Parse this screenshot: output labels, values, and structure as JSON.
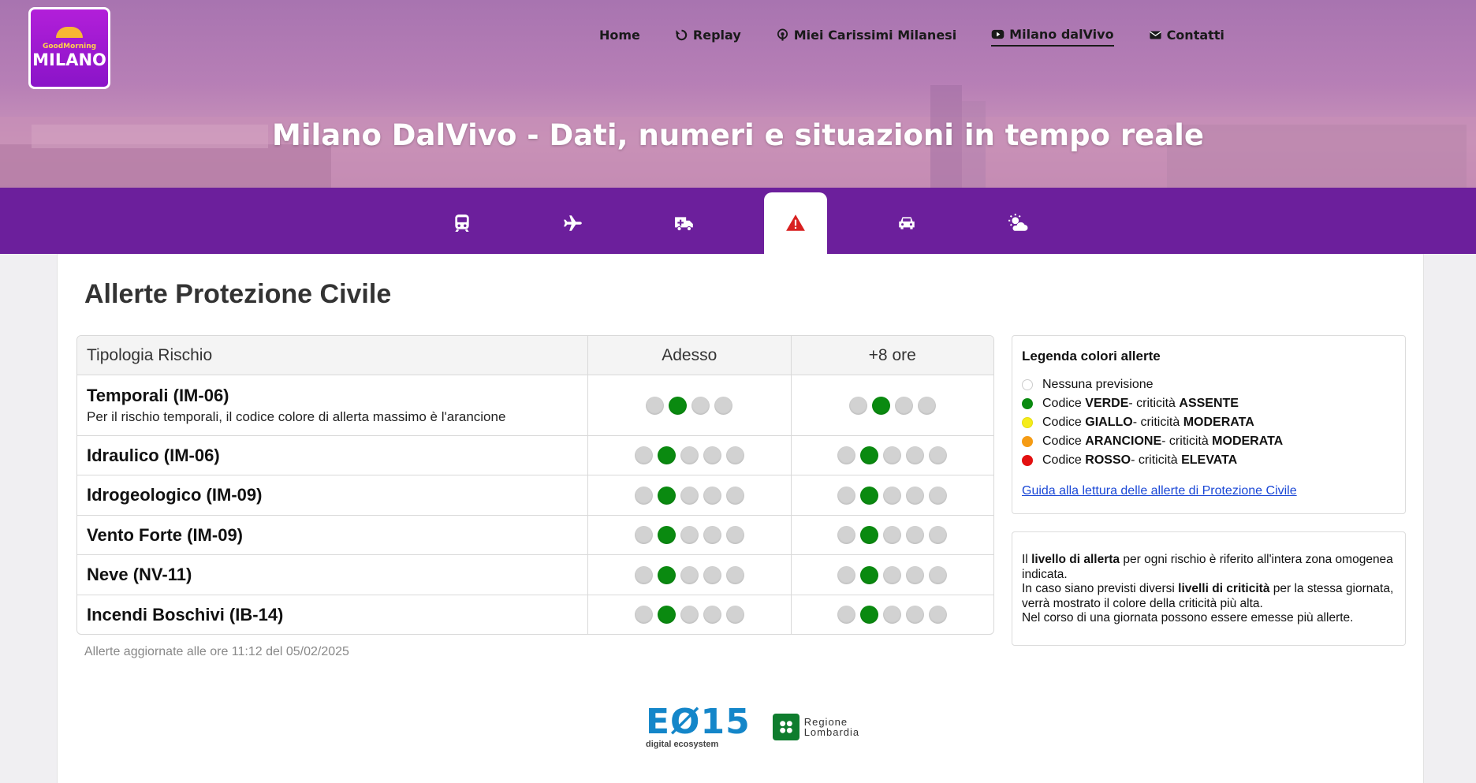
{
  "logo": {
    "tagline": "GoodMorning",
    "city": "MILANO"
  },
  "nav": {
    "items": [
      {
        "label": "Home",
        "icon": "none"
      },
      {
        "label": "Replay",
        "icon": "replay-icon"
      },
      {
        "label": "Miei Carissimi Milanesi",
        "icon": "podcast-icon"
      },
      {
        "label": "Milano dalVivo",
        "icon": "youtube-icon",
        "active": true
      },
      {
        "label": "Contatti",
        "icon": "envelope-icon"
      }
    ]
  },
  "hero": {
    "title": "Milano DalVivo - Dati, numeri e situazioni in tempo reale"
  },
  "tabs": [
    {
      "icon": "train-icon"
    },
    {
      "icon": "plane-icon"
    },
    {
      "icon": "ambulance-icon"
    },
    {
      "icon": "warning-icon",
      "active": true
    },
    {
      "icon": "car-icon"
    },
    {
      "icon": "weather-icon"
    }
  ],
  "colors": {
    "accent": "#6c1f9c",
    "green": "#0a8a10",
    "yellow": "#f5ec1a",
    "orange": "#f59b14",
    "red": "#e31010",
    "warning": "#d82020"
  },
  "main": {
    "title": "Allerte Protezione Civile",
    "table": {
      "headers": [
        "Tipologia Rischio",
        "Adesso",
        "+8 ore"
      ],
      "rows": [
        {
          "name": "Temporali (IM-06)",
          "note": "Per il rischio temporali, il codice colore di allerta massimo è l'arancione",
          "levels": 4,
          "now": 2,
          "later": 2
        },
        {
          "name": "Idraulico (IM-06)",
          "note": "",
          "levels": 5,
          "now": 2,
          "later": 2
        },
        {
          "name": "Idrogeologico (IM-09)",
          "note": "",
          "levels": 5,
          "now": 2,
          "later": 2
        },
        {
          "name": "Vento Forte (IM-09)",
          "note": "",
          "levels": 5,
          "now": 2,
          "later": 2
        },
        {
          "name": "Neve (NV-11)",
          "note": "",
          "levels": 5,
          "now": 2,
          "later": 2
        },
        {
          "name": "Incendi Boschivi (IB-14)",
          "note": "",
          "levels": 5,
          "now": 2,
          "later": 2
        }
      ]
    },
    "updated": "Allerte aggiornate alle ore 11:12 del 05/02/2025"
  },
  "legend": {
    "title": "Legenda colori allerte",
    "nessuna": "Nessuna previsione",
    "verde": {
      "prefix": "Codice ",
      "code": "VERDE",
      "mid": " - criticità ",
      "level": "ASSENTE"
    },
    "giallo": {
      "prefix": "Codice ",
      "code": "GIALLO",
      "mid": " - criticità ",
      "level": "MODERATA"
    },
    "arancione": {
      "prefix": "Codice ",
      "code": "ARANCIONE",
      "mid": " - criticità ",
      "level": "MODERATA"
    },
    "rosso": {
      "prefix": "Codice ",
      "code": "ROSSO",
      "mid": " - criticità ",
      "level": "ELEVATA"
    },
    "link": "Guida alla lettura delle allerte di Protezione Civile"
  },
  "info": {
    "p1_pre": "Il ",
    "p1_bold": "livello di allerta",
    "p1_post": " per ogni rischio è riferito all'intera zona omogenea indicata.",
    "p2_pre": "In caso siano previsti diversi ",
    "p2_bold": "livelli di criticità",
    "p2_post": " per la stessa giornata, verrà mostrato il colore della criticità più alta.",
    "p3": "Nel corso di una giornata possono essere emesse più allerte."
  },
  "partners": {
    "e015": "EØ15",
    "e015_sub": "digital ecosystem",
    "region_1": "Regione",
    "region_2": "Lombardia"
  }
}
